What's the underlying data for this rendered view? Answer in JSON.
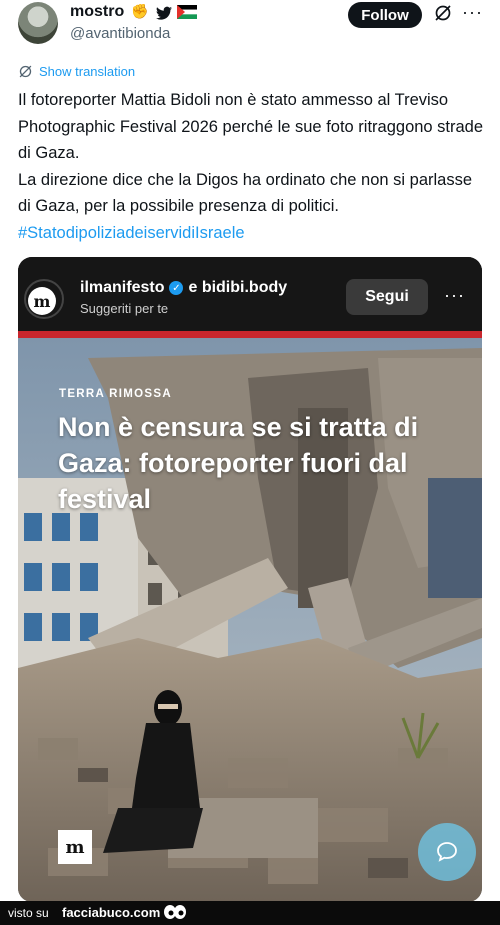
{
  "post": {
    "display_name": "mostro",
    "handle": "@avantibionda",
    "follow_label": "Follow",
    "more_label": "···",
    "show_translation": "Show translation",
    "text_lines": [
      "Il fotoreporter Mattia Bidoli non è stato ammesso al Treviso Photographic Festival 2026 perché le sue foto ritraggono strade di Gaza.",
      "La direzione dice che la Digos ha ordinato che non si parlasse di Gaza, per la possibile presenza di politici."
    ],
    "hashtag": "#StatodipoliziadeiservidiIsraele"
  },
  "card": {
    "account": "ilmanifesto",
    "and_label": "e bidibi.body",
    "suggested": "Suggeriti per te",
    "segui_label": "Segui",
    "more_label": "···",
    "logo_letter": "m",
    "kicker": "TERRA RIMOSSA",
    "headline": "Non è censura se si tratta di Gaza: fotoreporter fuori dal festival"
  },
  "watermark": {
    "left": "visto su",
    "brand": "facciabuco.com"
  },
  "colors": {
    "accent": "#1d9bf0",
    "red_bar": "#c8262d"
  }
}
